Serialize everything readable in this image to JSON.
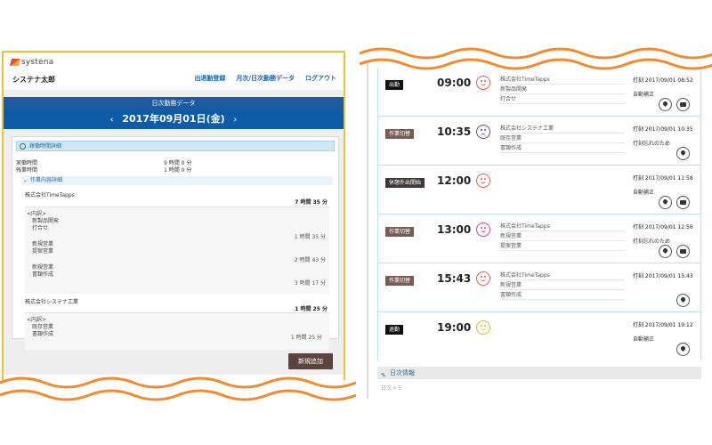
{
  "left": {
    "logo_text": "systena",
    "username": "システナ太郎",
    "nav": [
      "出退勤登録",
      "月次/日次勤務データ",
      "ログアウト"
    ],
    "day_header": "日次勤務データ",
    "date": "2017年09月01日(金)",
    "prev_chevron": "‹",
    "next_chevron": "›",
    "section_title": "稼働時間詳細",
    "actual_label": "実働時間",
    "actual_value": "9 時間 0 分",
    "overtime_label": "残業時間",
    "overtime_value": "1 時間 0 分",
    "work_detail_title": "作業内容詳細",
    "companies": [
      {
        "name": "株式会社TimeTapps",
        "total": "7 時間 35 分",
        "breakdown_label": "<内訳>",
        "items": [
          {
            "lines": [
              "新製品開発",
              "打合せ"
            ],
            "time": "1 時間 35 分"
          },
          {
            "lines": [
              "新規営業",
              "提案営業"
            ],
            "time": "2 時間 43 分"
          },
          {
            "lines": [
              "新規営業",
              "書類作成"
            ],
            "time": "3 時間 17 分"
          }
        ]
      },
      {
        "name": "株式会社システナ工業",
        "total": "1 時間 25 分",
        "breakdown_label": "<内訳>",
        "items": [
          {
            "lines": [
              "既存営業",
              "書類作成"
            ],
            "time": "1 時間 25 分"
          }
        ]
      }
    ],
    "add_button": "新規追加"
  },
  "right": {
    "rows": [
      {
        "badge": "出勤",
        "badge_style": "black",
        "time": "09:00",
        "mood": "red",
        "tasks": [
          "株式会社TimeTapps",
          "新製品開発",
          "打合せ"
        ],
        "stamp": "打刻 2017/09/01 08:52",
        "note": "自動補正",
        "buttons": [
          "pin",
          "chat"
        ]
      },
      {
        "badge": "作業切替",
        "badge_style": "brown",
        "time": "10:35",
        "mood": "purple",
        "tasks": [
          "株式会社システナ工業",
          "既存営業",
          "書類作成"
        ],
        "stamp": "打刻 2017/09/01 10:35",
        "note": "打刻忘れのため",
        "buttons": [
          "pin"
        ]
      },
      {
        "badge": "休憩外出開始",
        "badge_style": "dark",
        "time": "12:00",
        "mood": "red",
        "tasks": [],
        "stamp": "打刻 2017/09/01 11:58",
        "note": "自動補正",
        "buttons": [
          "pin",
          "chat"
        ]
      },
      {
        "badge": "作業切替",
        "badge_style": "brown",
        "time": "13:00",
        "mood": "pink",
        "tasks": [
          "株式会社TimeTapps",
          "新規営業",
          "提案営業"
        ],
        "stamp": "打刻 2017/09/01 12:56",
        "note": "打刻忘れのため",
        "buttons": [
          "pin",
          "chat"
        ]
      },
      {
        "badge": "作業切替",
        "badge_style": "brown",
        "time": "15:43",
        "mood": "red",
        "tasks": [
          "株式会社TimeTapps",
          "新規営業",
          "書類作成"
        ],
        "stamp": "打刻 2017/09/01 15:43",
        "note": "",
        "buttons": [
          "pin"
        ]
      },
      {
        "badge": "退勤",
        "badge_style": "black",
        "time": "19:00",
        "mood": "yellow",
        "tasks": [],
        "stamp": "打刻 2017/09/01 19:12",
        "note": "自動補正",
        "buttons": [
          "pin"
        ]
      }
    ],
    "footer_title": "日次情報",
    "memo_placeholder": "日次メモ"
  },
  "colors": {
    "accent_blue": "#0e5ba8",
    "frame_yellow": "#f2c230",
    "wave_orange": "#f28a2e",
    "button_brown": "#5b443b"
  }
}
